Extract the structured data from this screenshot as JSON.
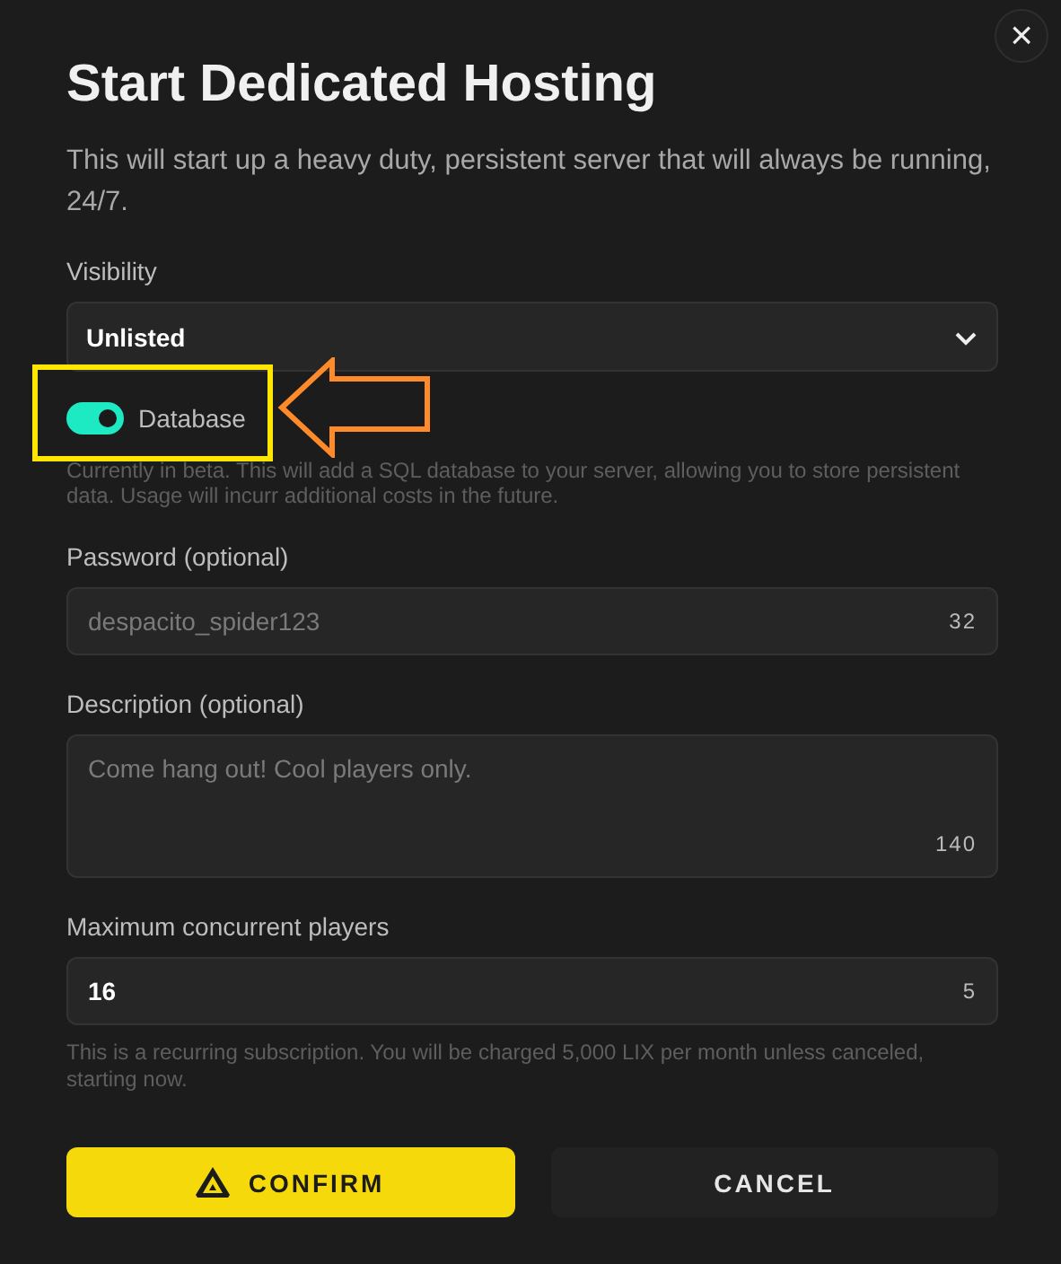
{
  "dialog": {
    "close": "×",
    "title": "Start Dedicated Hosting",
    "description": "This will start up a heavy duty, persistent server that will always be running, 24/7."
  },
  "visibility": {
    "label": "Visibility",
    "value": "Unlisted"
  },
  "database": {
    "label": "Database",
    "on": true,
    "help": "Currently in beta. This will add a SQL database to your server, allowing you to store persistent data. Usage will incurr additional costs in the future.",
    "highlighted": true
  },
  "password": {
    "label": "Password (optional)",
    "placeholder": "despacito_spider123",
    "counter": "32"
  },
  "description_field": {
    "label": "Description (optional)",
    "placeholder": "Come hang out! Cool players only.",
    "counter": "140"
  },
  "max_players": {
    "label": "Maximum concurrent players",
    "value": "16",
    "counter": "5",
    "note": "This is a recurring subscription. You will be charged 5,000 LIX per month unless canceled, starting now."
  },
  "buttons": [
    {
      "label": "CONFIRM",
      "kind": "primary"
    },
    {
      "label": "CANCEL",
      "kind": "secondary"
    }
  ]
}
